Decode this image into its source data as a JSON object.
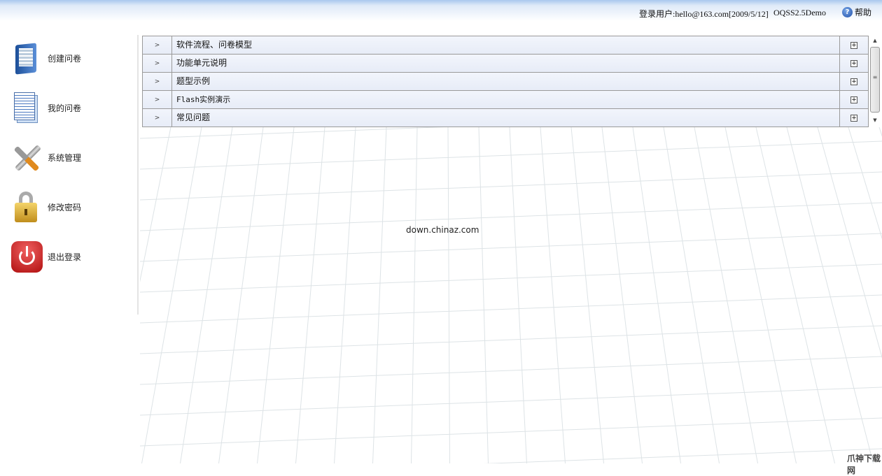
{
  "header": {
    "user_info": "登录用户:hello@163.com[2009/5/12]",
    "product": "OQSS2.5Demo",
    "help_label": "帮助"
  },
  "sidebar": {
    "items": [
      {
        "label": "创建问卷",
        "icon": "book-icon"
      },
      {
        "label": "我的问卷",
        "icon": "document-icon"
      },
      {
        "label": "系统管理",
        "icon": "tools-icon"
      },
      {
        "label": "修改密码",
        "icon": "lock-icon"
      },
      {
        "label": "退出登录",
        "icon": "power-icon"
      }
    ]
  },
  "panel": {
    "rows": [
      {
        "arrow": ">",
        "title": "软件流程、问卷模型",
        "expand": "+"
      },
      {
        "arrow": ">",
        "title": "功能单元说明",
        "expand": "+"
      },
      {
        "arrow": ">",
        "title": "题型示例",
        "expand": "+"
      },
      {
        "arrow": ">",
        "title": "Flash实例演示",
        "expand": "+"
      },
      {
        "arrow": ">",
        "title": "常见问题",
        "expand": "+"
      }
    ]
  },
  "center_text": "down.chinaz.com",
  "watermark": "爪神下载网"
}
